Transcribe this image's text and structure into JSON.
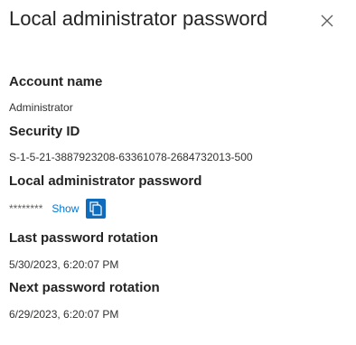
{
  "panel": {
    "title": "Local administrator password",
    "close_icon": "close-icon"
  },
  "fields": {
    "account_name": {
      "label": "Account name",
      "value": "Administrator"
    },
    "security_id": {
      "label": "Security ID",
      "value": "S-1-5-21-3887923208-63361078-2684732013-500"
    },
    "password": {
      "label": "Local administrator password",
      "masked_value": "********",
      "show_label": "Show",
      "copy_icon": "copy-icon"
    },
    "last_rotation": {
      "label": "Last password rotation",
      "value": "5/30/2023, 6:20:07 PM"
    },
    "next_rotation": {
      "label": "Next password rotation",
      "value": "6/29/2023, 6:20:07 PM"
    }
  },
  "colors": {
    "link": "#0078d4",
    "copy_button_bg": "#0f6cbd",
    "text": "#242424"
  }
}
